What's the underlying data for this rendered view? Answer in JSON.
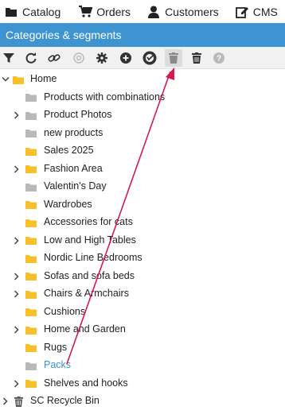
{
  "topnav": {
    "items": [
      {
        "label": "Catalog",
        "icon": "folder-icon"
      },
      {
        "label": "Orders",
        "icon": "cart-icon"
      },
      {
        "label": "Customers",
        "icon": "user-icon"
      },
      {
        "label": "CMS",
        "icon": "edit-icon"
      }
    ]
  },
  "panel": {
    "title": "Categories & segments"
  },
  "toolbar": {
    "buttons": [
      {
        "name": "filter-icon"
      },
      {
        "name": "refresh-icon"
      },
      {
        "name": "link-icon"
      },
      {
        "name": "at-icon"
      },
      {
        "name": "gear-icon"
      },
      {
        "name": "add-icon"
      },
      {
        "name": "mark-icon"
      },
      {
        "name": "trash-active-icon"
      },
      {
        "name": "trash-icon"
      },
      {
        "name": "help-icon"
      }
    ]
  },
  "colors": {
    "header_bg": "#3d94d1",
    "folder_yellow": "#f5c02c",
    "folder_gray": "#b9b9b9",
    "selected_text": "#3a8fd0",
    "arrow": "#d6194f"
  },
  "tree": {
    "root": {
      "label": "Home"
    },
    "items": [
      {
        "label": "Products with combinations",
        "folder": "gray",
        "expandable": false
      },
      {
        "label": "Product Photos",
        "folder": "gray",
        "expandable": true
      },
      {
        "label": "new products",
        "folder": "gray",
        "expandable": false
      },
      {
        "label": "Sales 2025",
        "folder": "yellow",
        "expandable": false
      },
      {
        "label": "Fashion Area",
        "folder": "yellow",
        "expandable": true
      },
      {
        "label": "Valentin's Day",
        "folder": "gray",
        "expandable": false
      },
      {
        "label": "Wardrobes",
        "folder": "yellow",
        "expandable": false
      },
      {
        "label": "Accessories for cats",
        "folder": "yellow",
        "expandable": false
      },
      {
        "label": "Low and High Tables",
        "folder": "yellow",
        "expandable": true
      },
      {
        "label": "Nordic Line Bedrooms",
        "folder": "yellow",
        "expandable": false
      },
      {
        "label": "Sofas and sofa beds",
        "folder": "yellow",
        "expandable": true
      },
      {
        "label": "Chairs & Armchairs",
        "folder": "yellow",
        "expandable": true
      },
      {
        "label": "Cushions",
        "folder": "yellow",
        "expandable": false
      },
      {
        "label": "Home and Garden",
        "folder": "yellow",
        "expandable": true
      },
      {
        "label": "Rugs",
        "folder": "yellow",
        "expandable": false
      },
      {
        "label": "Packs",
        "folder": "gray",
        "expandable": false,
        "selected": true
      },
      {
        "label": "Shelves and hooks",
        "folder": "yellow",
        "expandable": true
      }
    ],
    "recycle": {
      "label": "SC Recycle Bin"
    }
  }
}
